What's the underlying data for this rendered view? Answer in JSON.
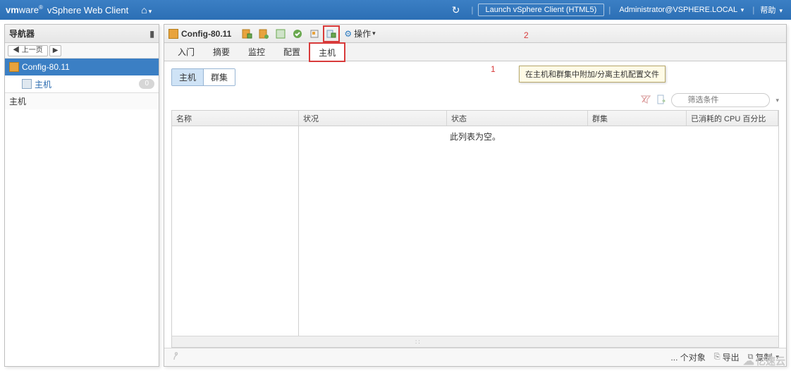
{
  "banner": {
    "brand_prefix": "vm",
    "brand_suffix": "ware",
    "product": "vSphere Web Client",
    "launch_btn": "Launch vSphere Client (HTML5)",
    "user": "Administrator@VSPHERE.LOCAL",
    "help": "帮助"
  },
  "nav": {
    "title": "导航器",
    "back_label": "上一页",
    "item_profile": "Config-80.11",
    "item_host": "主机",
    "item_host_count": "0",
    "section_hosts": "主机"
  },
  "content": {
    "title": "Config-80.11",
    "actions_label": "操作",
    "tooltip": "在主机和群集中附加/分离主机配置文件",
    "mark1": "1",
    "mark2": "2",
    "tabs": {
      "getting_started": "入门",
      "summary": "摘要",
      "monitor": "监控",
      "configure": "配置",
      "hosts": "主机"
    },
    "subtabs": {
      "hosts": "主机",
      "clusters": "群集"
    },
    "filter_placeholder": "筛选条件",
    "columns": {
      "name": "名称",
      "status": "状况",
      "state": "状态",
      "cluster": "群集",
      "cpu": "已消耗的 CPU 百分比"
    },
    "empty": "此列表为空。",
    "footer": {
      "count": "... 个对象",
      "export": "导出",
      "copy": "复制"
    }
  },
  "watermark": "亿速云"
}
